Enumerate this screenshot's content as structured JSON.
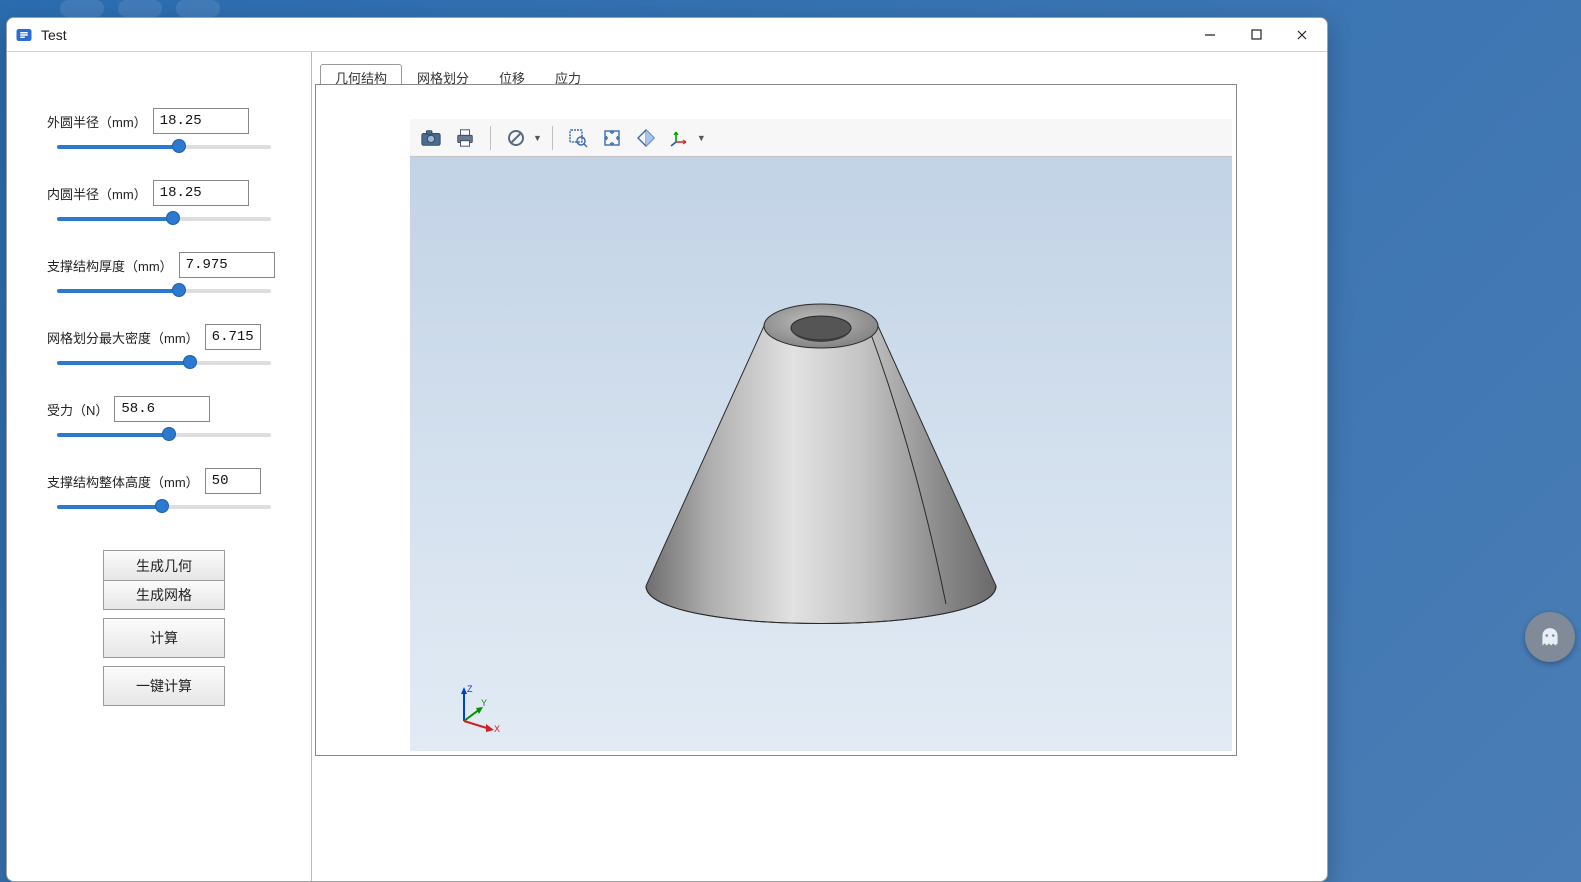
{
  "window": {
    "title": "Test",
    "controls": {
      "minimize": "−",
      "maximize": "▢",
      "close": "✕"
    }
  },
  "sidebar": {
    "params": [
      {
        "label": "外圆半径（mm）",
        "value": "18.25",
        "slider_pct": 58,
        "narrow": false
      },
      {
        "label": "内圆半径（mm）",
        "value": "18.25",
        "slider_pct": 55,
        "narrow": false
      },
      {
        "label": "支撑结构厚度（mm）",
        "value": "7.975",
        "slider_pct": 58,
        "narrow": false
      },
      {
        "label": "网格划分最大密度（mm）",
        "value": "6.715",
        "slider_pct": 63,
        "narrow": true
      },
      {
        "label": "受力（N）",
        "value": "58.6",
        "slider_pct": 53,
        "narrow": false
      },
      {
        "label": "支撑结构整体高度（mm）",
        "value": "50",
        "slider_pct": 50,
        "narrow": true
      }
    ],
    "buttons": {
      "gen_geom": "生成几何",
      "gen_mesh": "生成网格",
      "compute": "计算",
      "one_click": "一键计算"
    }
  },
  "tabs": {
    "items": [
      "几何结构",
      "网格划分",
      "位移",
      "应力"
    ],
    "active_index": 0
  },
  "view_toolbar": {
    "icons": [
      "camera",
      "print",
      "circle-slash",
      "zoom-box",
      "fit",
      "transparency",
      "axes"
    ]
  },
  "axis_labels": {
    "x": "X",
    "y": "Y",
    "z": "Z"
  }
}
